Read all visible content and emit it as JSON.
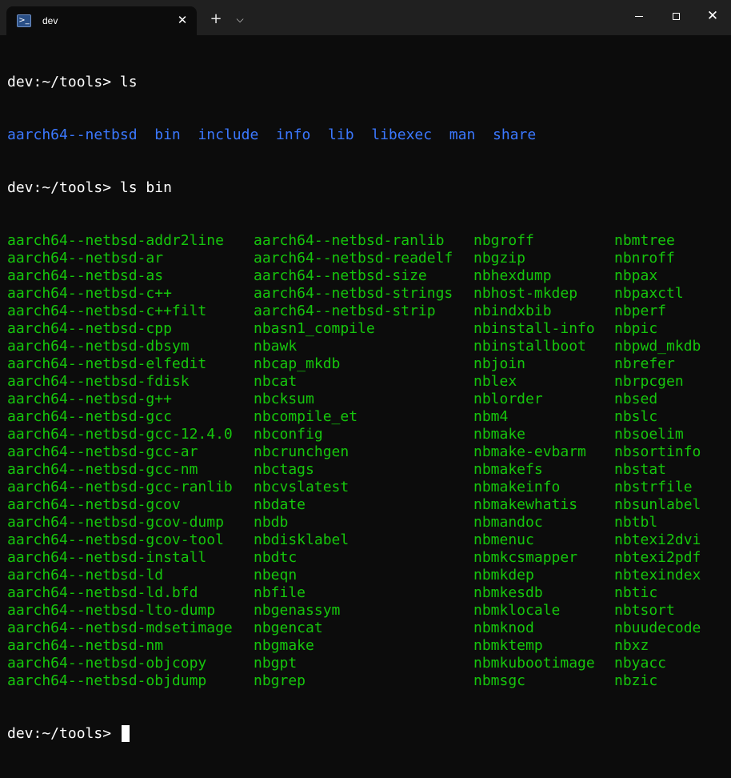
{
  "window": {
    "tab_title": "dev",
    "tab_icon": "powershell-icon",
    "new_tab_label": "+",
    "dropdown_label": "⌵",
    "close_tab_label": "✕",
    "close_window_label": "✕"
  },
  "colors": {
    "background": "#0c0c0c",
    "titlebar": "#202020",
    "directory": "#3b78ff",
    "executable": "#16c60c",
    "text": "#ffffff"
  },
  "terminal": {
    "prompt": "dev:~/tools> ",
    "command1": "ls",
    "dirs": [
      "aarch64--netbsd",
      "bin",
      "include",
      "info",
      "lib",
      "libexec",
      "man",
      "share"
    ],
    "command2": "ls bin",
    "rows": [
      [
        "aarch64--netbsd-addr2line",
        "aarch64--netbsd-ranlib",
        "nbgroff",
        "nbmtree"
      ],
      [
        "aarch64--netbsd-ar",
        "aarch64--netbsd-readelf",
        "nbgzip",
        "nbnroff"
      ],
      [
        "aarch64--netbsd-as",
        "aarch64--netbsd-size",
        "nbhexdump",
        "nbpax"
      ],
      [
        "aarch64--netbsd-c++",
        "aarch64--netbsd-strings",
        "nbhost-mkdep",
        "nbpaxctl"
      ],
      [
        "aarch64--netbsd-c++filt",
        "aarch64--netbsd-strip",
        "nbindxbib",
        "nbperf"
      ],
      [
        "aarch64--netbsd-cpp",
        "nbasn1_compile",
        "nbinstall-info",
        "nbpic"
      ],
      [
        "aarch64--netbsd-dbsym",
        "nbawk",
        "nbinstallboot",
        "nbpwd_mkdb"
      ],
      [
        "aarch64--netbsd-elfedit",
        "nbcap_mkdb",
        "nbjoin",
        "nbrefer"
      ],
      [
        "aarch64--netbsd-fdisk",
        "nbcat",
        "nblex",
        "nbrpcgen"
      ],
      [
        "aarch64--netbsd-g++",
        "nbcksum",
        "nblorder",
        "nbsed"
      ],
      [
        "aarch64--netbsd-gcc",
        "nbcompile_et",
        "nbm4",
        "nbslc"
      ],
      [
        "aarch64--netbsd-gcc-12.4.0",
        "nbconfig",
        "nbmake",
        "nbsoelim"
      ],
      [
        "aarch64--netbsd-gcc-ar",
        "nbcrunchgen",
        "nbmake-evbarm",
        "nbsortinfo"
      ],
      [
        "aarch64--netbsd-gcc-nm",
        "nbctags",
        "nbmakefs",
        "nbstat"
      ],
      [
        "aarch64--netbsd-gcc-ranlib",
        "nbcvslatest",
        "nbmakeinfo",
        "nbstrfile"
      ],
      [
        "aarch64--netbsd-gcov",
        "nbdate",
        "nbmakewhatis",
        "nbsunlabel"
      ],
      [
        "aarch64--netbsd-gcov-dump",
        "nbdb",
        "nbmandoc",
        "nbtbl"
      ],
      [
        "aarch64--netbsd-gcov-tool",
        "nbdisklabel",
        "nbmenuc",
        "nbtexi2dvi"
      ],
      [
        "aarch64--netbsd-install",
        "nbdtc",
        "nbmkcsmapper",
        "nbtexi2pdf"
      ],
      [
        "aarch64--netbsd-ld",
        "nbeqn",
        "nbmkdep",
        "nbtexindex"
      ],
      [
        "aarch64--netbsd-ld.bfd",
        "nbfile",
        "nbmkesdb",
        "nbtic"
      ],
      [
        "aarch64--netbsd-lto-dump",
        "nbgenassym",
        "nbmklocale",
        "nbtsort"
      ],
      [
        "aarch64--netbsd-mdsetimage",
        "nbgencat",
        "nbmknod",
        "nbuudecode"
      ],
      [
        "aarch64--netbsd-nm",
        "nbgmake",
        "nbmktemp",
        "nbxz"
      ],
      [
        "aarch64--netbsd-objcopy",
        "nbgpt",
        "nbmkubootimage",
        "nbyacc"
      ],
      [
        "aarch64--netbsd-objdump",
        "nbgrep",
        "nbmsgc",
        "nbzic"
      ]
    ],
    "final_prompt": "dev:~/tools> "
  }
}
